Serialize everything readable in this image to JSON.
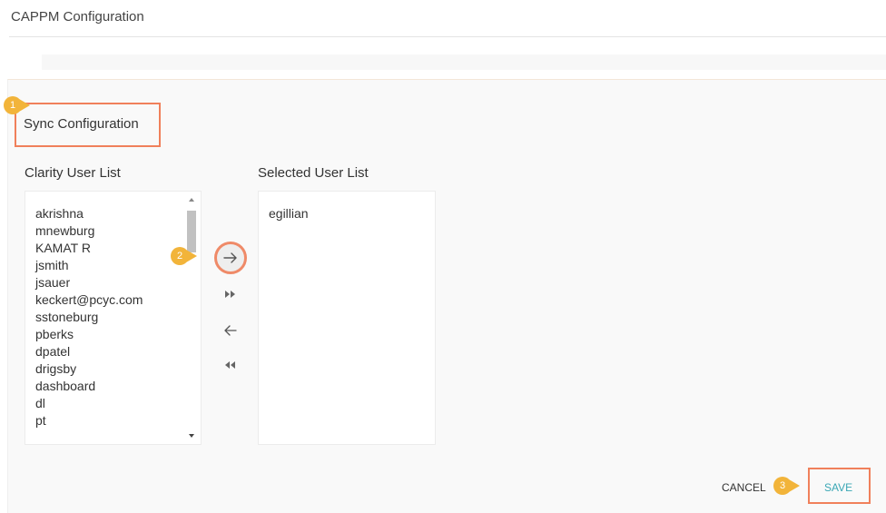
{
  "page": {
    "title": "CAPPM Configuration"
  },
  "section": {
    "title": "Sync Configuration"
  },
  "callouts": {
    "one": "1",
    "two": "2",
    "three": "3"
  },
  "clarity_list": {
    "label": "Clarity User List",
    "items": [
      "akrishna",
      "mnewburg",
      "KAMAT R",
      "jsmith",
      "jsauer",
      "keckert@pcyc.com",
      "sstoneburg",
      "pberks",
      "dpatel",
      "drigsby",
      "dashboard",
      "dl",
      "pt"
    ]
  },
  "selected_list": {
    "label": "Selected User List",
    "items": [
      "egillian"
    ]
  },
  "icons": {
    "move_right": "arrow-right-icon",
    "move_all_right": "double-chevron-right-icon",
    "move_left": "arrow-left-icon",
    "move_all_left": "double-chevron-left-icon"
  },
  "footer": {
    "cancel_label": "CANCEL",
    "save_label": "SAVE"
  },
  "colors": {
    "accent": "#3aa7b5",
    "callout_border": "#f0805b",
    "badge": "#f2b43a"
  }
}
